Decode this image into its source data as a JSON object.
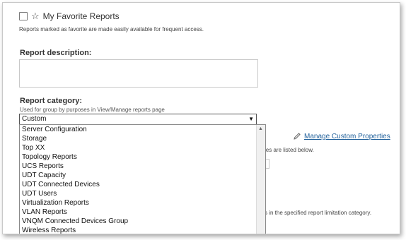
{
  "favorite": {
    "label": "My Favorite Reports",
    "description": "Reports marked as favorite are made easily available for frequent access.",
    "checked": false
  },
  "report_description": {
    "label": "Report description:",
    "value": ""
  },
  "report_category": {
    "label": "Report category:",
    "hint": "Used for group by purposes in View/Manage reports page",
    "selected": "Custom",
    "options": [
      "Server Configuration",
      "Storage",
      "Top XX",
      "Topology Reports",
      "UCS Reports",
      "UDT Capacity",
      "UDT Connected Devices",
      "UDT Users",
      "Virtualization Reports",
      "VLAN Reports",
      "VNQM Connected Devices Group",
      "Wireless Reports"
    ]
  },
  "custom_properties": {
    "link_label": "Manage Custom Properties",
    "partial_text_1": "ies are listed below.",
    "partial_text_2": "s in the specified report limitation category."
  },
  "icons": {
    "favorite": "star-icon",
    "edit": "pencil-icon",
    "dropdown": "triangle-down-icon"
  },
  "colors": {
    "link": "#1f5f9a",
    "border": "#c8c8c8"
  }
}
